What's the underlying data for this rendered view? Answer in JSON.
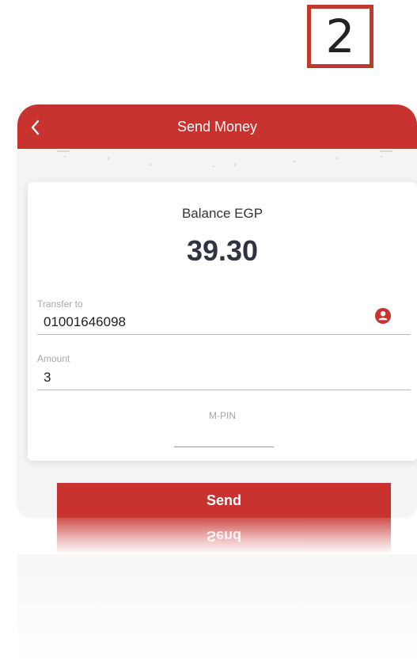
{
  "step_badge": {
    "number": "2"
  },
  "header": {
    "title": "Send Money",
    "back_icon": "chevron-left-icon"
  },
  "balance": {
    "label": "Balance EGP",
    "value": "39.30"
  },
  "transfer_to": {
    "label": "Transfer to",
    "value": "01001646098",
    "icon": "contact-person-icon"
  },
  "amount": {
    "label": "Amount",
    "value": "3"
  },
  "mpin": {
    "label": "M-PIN",
    "value": ""
  },
  "send_button": {
    "label": "Send"
  },
  "colors": {
    "brand_red": "#c8322f",
    "badge_border": "#c0392b",
    "text_dark": "#2e3440"
  }
}
